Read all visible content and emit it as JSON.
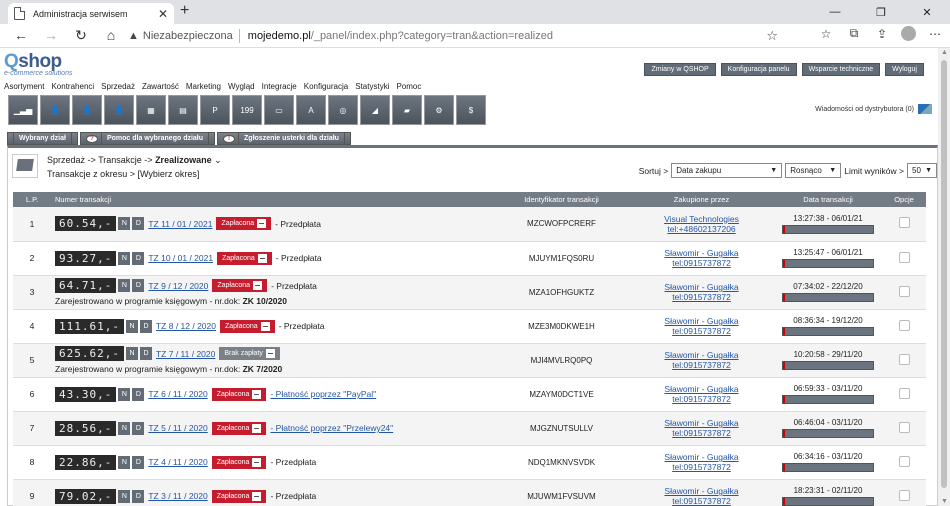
{
  "browser": {
    "tab_title": "Administracja serwisem",
    "insecure_label": "Niezabezpieczona",
    "url_host": "mojedemo.pl",
    "url_path": "/_panel/index.php?category=tran&action=realized"
  },
  "logo": {
    "q": "Q",
    "shop": "shop",
    "sub": "e-commerce solutions"
  },
  "top_buttons": [
    "Zmiany w QSHOP",
    "Konfiguracja panelu",
    "Wsparcie techniczne",
    "Wyloguj"
  ],
  "menu": [
    "Asortyment",
    "Kontrahenci",
    "Sprzedaż",
    "Zawartość",
    "Marketing",
    "Wygląd",
    "Integracje",
    "Konfiguracja",
    "Statystyki",
    "Pomoc"
  ],
  "messages": "Wiadomości od dystrybutora (0)",
  "section_tabs": [
    "Wybrany dział",
    "Pomoc dla wybranego działu",
    "Zgłoszenie usterki dla działu"
  ],
  "breadcrumb": {
    "path": "Sprzedaż -> Transakcje -> ",
    "current": "Zrealizowane"
  },
  "period": {
    "label": "Transakcje z okresu >",
    "value": "[Wybierz okres]"
  },
  "sort": {
    "label": "Sortuj >",
    "field": "Data zakupu",
    "order": "Rosnąco",
    "limit_label": "Limit wyników >",
    "limit": "50"
  },
  "columns": {
    "lp": "L.P.",
    "nr": "Numer transakcji",
    "id": "Identyfikator transakcji",
    "buyer": "Zakupione przez",
    "date": "Data transakcji",
    "opts": "Opcje"
  },
  "rows": [
    {
      "lp": "1",
      "amt": "60.54,-",
      "tz": "TZ 11 / 01 / 2021",
      "status": "Zapłacona",
      "pay": "- Przedpłata",
      "ksieg": "",
      "id": "MZCWOFPCRERF",
      "buyer": "Visual Technologies",
      "tel": "tel:+48602137206",
      "date": "13:27:38 - 06/01/21"
    },
    {
      "lp": "2",
      "amt": "93.27,-",
      "tz": "TZ 10 / 01 / 2021",
      "status": "Zapłacona",
      "pay": "- Przedpłata",
      "ksieg": "",
      "id": "MJUYM1FQS0RU",
      "buyer": "Sławomir - Gugałka",
      "tel": "tel:0915737872",
      "date": "13:25:47 - 06/01/21"
    },
    {
      "lp": "3",
      "amt": "64.71,-",
      "tz": "TZ 9 / 12 / 2020",
      "status": "Zapłacona",
      "pay": "- Przedpłata",
      "ksieg": "ZK 10/2020",
      "id": "MZA1OFHGUKTZ",
      "buyer": "Sławomir - Gugałka",
      "tel": "tel:0915737872",
      "date": "07:34:02 - 22/12/20"
    },
    {
      "lp": "4",
      "amt": "111.61,-",
      "tz": "TZ 8 / 12 / 2020",
      "status": "Zapłacona",
      "pay": "- Przedpłata",
      "ksieg": "",
      "id": "MZE3M0DKWE1H",
      "buyer": "Sławomir - Gugałka",
      "tel": "tel:0915737872",
      "date": "08:36:34 - 19/12/20"
    },
    {
      "lp": "5",
      "amt": "625.62,-",
      "tz": "TZ 7 / 11 / 2020",
      "status": "Brak zapłaty",
      "pay": "",
      "ksieg": "ZK 7/2020",
      "id": "MJI4MVLRQ0PQ",
      "buyer": "Sławomir - Gugałka",
      "tel": "tel:0915737872",
      "date": "10:20:58 - 29/11/20"
    },
    {
      "lp": "6",
      "amt": "43.30,-",
      "tz": "TZ 6 / 11 / 2020",
      "status": "Zapłacona",
      "pay": "- Płatność poprzez \"PayPal\"",
      "ksieg": "",
      "id": "MZAYM0DCT1VE",
      "buyer": "Sławomir - Gugałka",
      "tel": "tel:0915737872",
      "date": "06:59:33 - 03/11/20"
    },
    {
      "lp": "7",
      "amt": "28.56,-",
      "tz": "TZ 5 / 11 / 2020",
      "status": "Zapłacona",
      "pay": "- Płatność poprzez \"Przelewy24\"",
      "ksieg": "",
      "id": "MJGZNUTSULLV",
      "buyer": "Sławomir - Gugałka",
      "tel": "tel:0915737872",
      "date": "06:46:04 - 03/11/20"
    },
    {
      "lp": "8",
      "amt": "22.86,-",
      "tz": "TZ 4 / 11 / 2020",
      "status": "Zapłacona",
      "pay": "- Przedpłata",
      "ksieg": "",
      "id": "NDQ1MKNVSVDK",
      "buyer": "Sławomir - Gugałka",
      "tel": "tel:0915737872",
      "date": "06:34:16 - 03/11/20"
    },
    {
      "lp": "9",
      "amt": "79.02,-",
      "tz": "TZ 3 / 11 / 2020",
      "status": "Zapłacona",
      "pay": "- Przedpłata",
      "ksieg": "",
      "id": "MJUWM1FVSUVM",
      "buyer": "Sławomir - Gugałka",
      "tel": "tel:0915737872",
      "date": "18:23:31 - 02/11/20"
    }
  ],
  "ksieg_prefix": "Zarejestrowano w programie księgowym - nr.dok:",
  "nd_labels": [
    "N",
    "D"
  ]
}
